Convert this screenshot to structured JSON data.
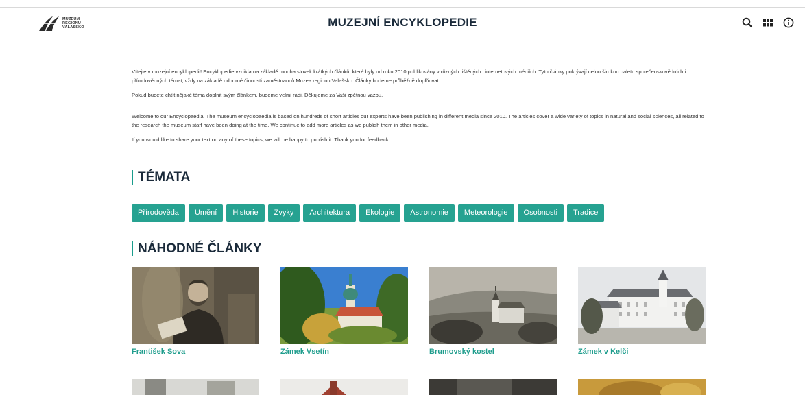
{
  "header": {
    "logo_lines": [
      "MUZEUM",
      "REGIONU",
      "VALAŠSKO"
    ],
    "title": "MUZEJNÍ ENCYKLOPEDIE",
    "icons": [
      "search-icon",
      "grid-icon",
      "info-icon"
    ]
  },
  "intro": {
    "cz_p1": "Vítejte v muzejní encyklopedii! Encyklopedie vznikla na základě mnoha stovek krátkých článků, které byly od roku 2010 publikovány v různých tištěných i internetových médiích. Tyto články pokrývají celou širokou paletu společenskovědních i přírodovědných témat, vždy na základě odborné činnosti zaměstnanců Muzea regionu Valašsko. Články budeme průběžně doplňovat.",
    "cz_p2": "Pokud budete chtít nějaké téma doplnit svým článkem, budeme velmi rádi. Děkujeme za Vaši zpětnou vazbu.",
    "en_p1": "Welcome to our Encyclopaedia! The museum encyclopaedia is based on hundreds of short articles our experts have been publishing in different media since 2010. The articles cover a wide variety of topics in natural and social sciences, all related to the research the museum staff have been doing at the time. We continue to add more articles as we publish them in other media.",
    "en_p2": "If you would like to share your text on any of these topics, we will be happy to publish it. Thank you for feedback."
  },
  "topics": {
    "heading": "TÉMATA",
    "items": [
      "Přírodověda",
      "Umění",
      "Historie",
      "Zvyky",
      "Architektura",
      "Ekologie",
      "Astronomie",
      "Meteorologie",
      "Osobnosti",
      "Tradice"
    ]
  },
  "random": {
    "heading": "NÁHODNÉ ČLÁNKY",
    "articles": [
      {
        "title": "František Sova"
      },
      {
        "title": "Zámek Vsetín"
      },
      {
        "title": "Brumovský kostel"
      },
      {
        "title": "Zámek v Kelči"
      }
    ]
  },
  "colors": {
    "accent": "#26a291",
    "link": "#1f9d8d",
    "heading": "#1a2a3a"
  }
}
